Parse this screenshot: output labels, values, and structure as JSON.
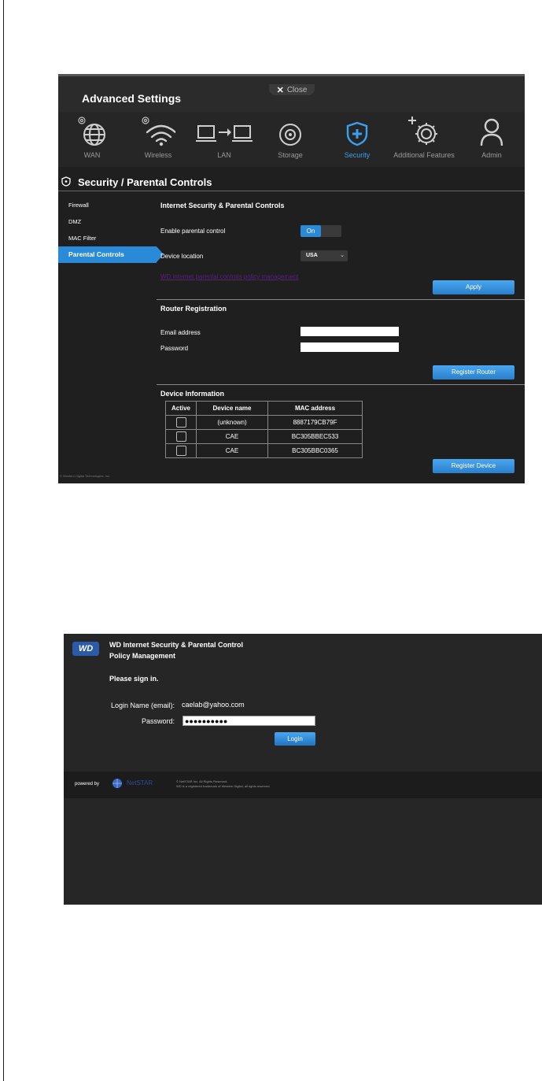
{
  "advanced": {
    "title": "Advanced Settings",
    "close_label": "Close",
    "nav": [
      {
        "label": "WAN",
        "icon": "globe-icon"
      },
      {
        "label": "Wireless",
        "icon": "wifi-icon"
      },
      {
        "label": "LAN",
        "icon": "lan-icon"
      },
      {
        "label": "Storage",
        "icon": "storage-icon"
      },
      {
        "label": "Security",
        "icon": "shield-icon",
        "active": true
      },
      {
        "label": "Additional Features",
        "icon": "gear-plus-icon"
      },
      {
        "label": "Admin",
        "icon": "user-icon"
      }
    ],
    "section_title": "Security / Parental Controls",
    "sidebar": [
      "Firewall",
      "DMZ",
      "MAC Filter",
      "Parental Controls"
    ],
    "sidebar_active": "Parental Controls",
    "parental": {
      "heading": "Internet Security & Parental Controls",
      "enable_label": "Enable parental control",
      "toggle_on": "On",
      "location_label": "Device location",
      "location_value": "USA",
      "policy_link": "WD internet parental controls policy management",
      "apply": "Apply"
    },
    "registration": {
      "heading": "Router Registration",
      "email_label": "Email address",
      "password_label": "Password",
      "button": "Register Router"
    },
    "device_info": {
      "heading": "Device Information",
      "columns": [
        "Active",
        "Device name",
        "MAC address"
      ],
      "rows": [
        {
          "name": "(unknown)",
          "mac": "8887179CB79F"
        },
        {
          "name": "CAE",
          "mac": "BC305BBEC533"
        },
        {
          "name": "CAE",
          "mac": "BC305BBC0365"
        }
      ],
      "button": "Register Device"
    },
    "copyright": "© Western Digital Technologies, Inc."
  },
  "wd": {
    "logo": "WD",
    "title_line1": "WD Internet Security & Parental Control",
    "title_line2": "Policy Management",
    "signin": "Please sign in.",
    "login_label": "Login Name (email):",
    "login_value": "caelab@yahoo.com",
    "password_label": "Password:",
    "password_value": "●●●●●●●●●●",
    "login_button": "Login",
    "powered_by": "powered by",
    "netstar": "NetSTAR",
    "copy_line1": "© NetSTAR Inc. All Rights Reserved.",
    "copy_line2": "WD is a registered trademark of Western Digital, all rights reserved."
  },
  "colors": {
    "accent": "#2a8ad8",
    "panel_bg": "#1f1f1f",
    "link": "#5a1f80"
  }
}
